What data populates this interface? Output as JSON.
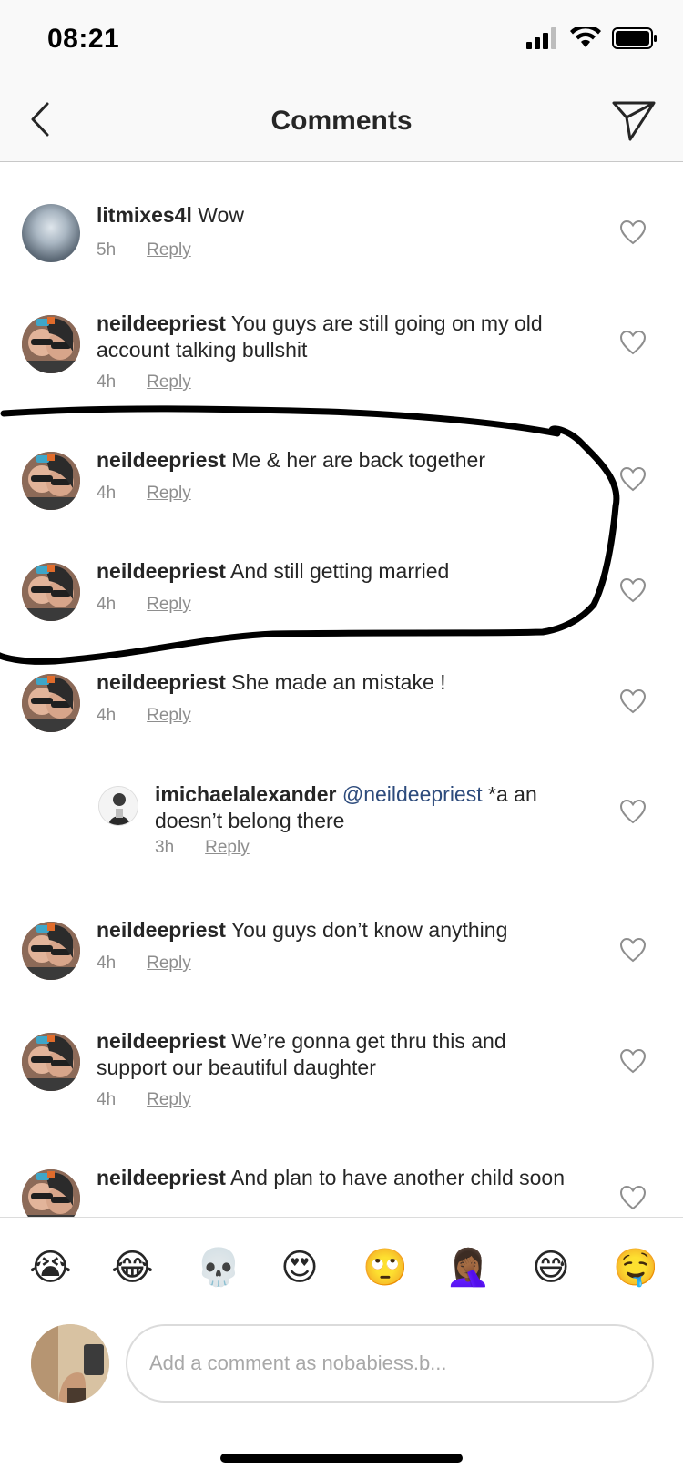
{
  "status_bar": {
    "time": "08:21"
  },
  "nav": {
    "title": "Comments"
  },
  "comments": [
    {
      "user": "litmixes4l",
      "text": "Wow",
      "time": "5h",
      "reply_label": "Reply"
    },
    {
      "user": "neildeepriest",
      "text": "You guys are still going on my old account talking bullshit",
      "time": "4h",
      "reply_label": "Reply"
    },
    {
      "user": "neildeepriest",
      "text": "Me & her are back together",
      "time": "4h",
      "reply_label": "Reply"
    },
    {
      "user": "neildeepriest",
      "text": "And still getting married",
      "time": "4h",
      "reply_label": "Reply"
    },
    {
      "user": "neildeepriest",
      "text": "She made an mistake !",
      "time": "4h",
      "reply_label": "Reply"
    },
    {
      "user": "imichaelalexander",
      "mention": "@neildeepriest",
      "text": "*a an doesn’t belong there",
      "time": "3h",
      "reply_label": "Reply"
    },
    {
      "user": "neildeepriest",
      "text": "You guys don’t know anything",
      "time": "4h",
      "reply_label": "Reply"
    },
    {
      "user": "neildeepriest",
      "text": "We’re gonna get thru this and support our beautiful daughter",
      "time": "4h",
      "reply_label": "Reply"
    },
    {
      "user": "neildeepriest",
      "text": "And plan to have another child soon",
      "time": "",
      "reply_label": ""
    }
  ],
  "emojis": [
    "😭",
    "😂",
    "💀",
    "😍",
    "🙄",
    "🤦🏾‍♀️",
    "😅",
    "🤤"
  ],
  "composer": {
    "placeholder": "Add a comment as nobabiess.b..."
  },
  "colors": {
    "accent_mention": "#2d4b7c",
    "meta_gray": "#8e8e8e",
    "marker": "#000000"
  }
}
